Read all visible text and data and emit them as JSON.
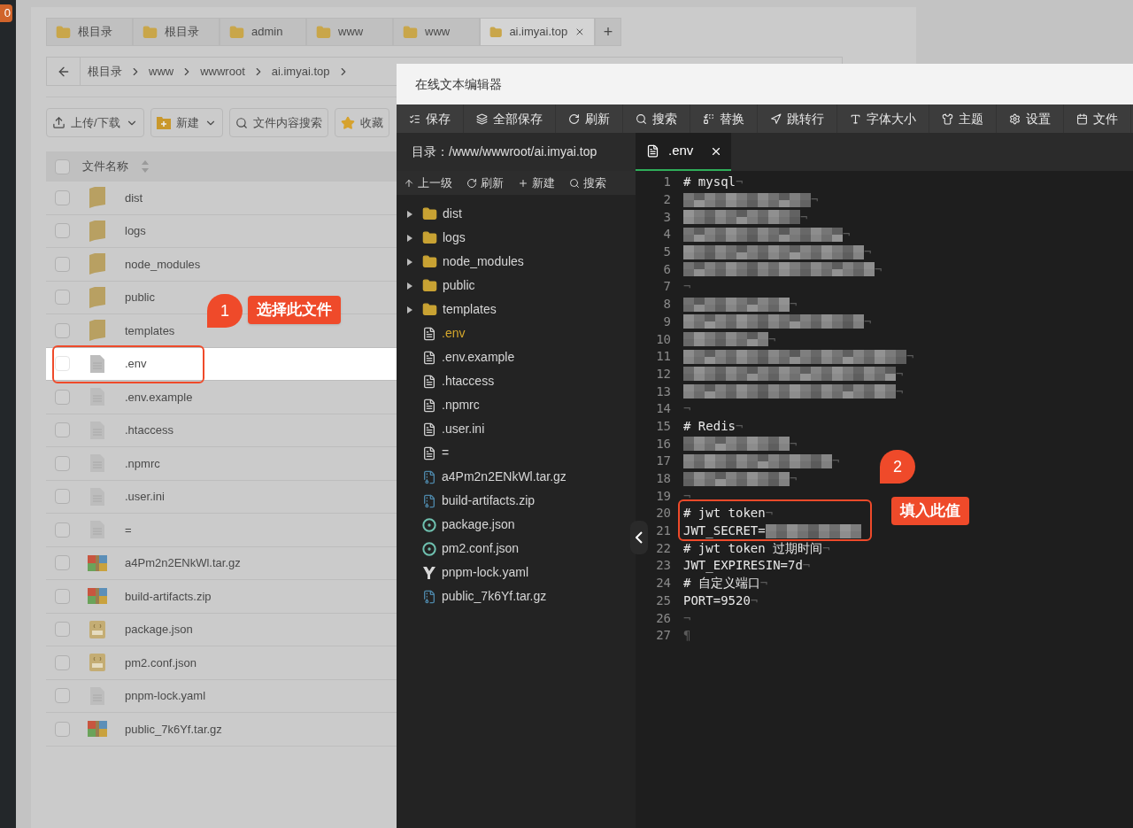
{
  "sidebar_badge": "0",
  "tabs": [
    {
      "label": "根目录",
      "selected": false,
      "closable": false
    },
    {
      "label": "根目录",
      "selected": false,
      "closable": false
    },
    {
      "label": "admin",
      "selected": false,
      "closable": false
    },
    {
      "label": "www",
      "selected": false,
      "closable": false
    },
    {
      "label": "www",
      "selected": false,
      "closable": false
    },
    {
      "label": "ai.imyai.top",
      "selected": true,
      "closable": true
    }
  ],
  "new_tab": "+",
  "breadcrumb": [
    "根目录",
    "www",
    "wwwroot",
    "ai.imyai.top"
  ],
  "toolbar": [
    {
      "label": "上传/下载",
      "kind": "upload"
    },
    {
      "label": "新建",
      "kind": "new"
    },
    {
      "label": "文件内容搜索",
      "kind": "search"
    },
    {
      "label": "收藏",
      "kind": "favorites"
    }
  ],
  "table": {
    "header": "文件名称",
    "header_checked": false,
    "rows": [
      {
        "name": "dist",
        "kind": "folder",
        "highlighted": false
      },
      {
        "name": "logs",
        "kind": "folder",
        "highlighted": false
      },
      {
        "name": "node_modules",
        "kind": "folder",
        "highlighted": false
      },
      {
        "name": "public",
        "kind": "folder",
        "highlighted": false
      },
      {
        "name": "templates",
        "kind": "folder",
        "highlighted": false
      },
      {
        "name": ".env",
        "kind": "file",
        "highlighted": true
      },
      {
        "name": ".env.example",
        "kind": "file",
        "highlighted": false
      },
      {
        "name": ".htaccess",
        "kind": "file",
        "highlighted": false
      },
      {
        "name": ".npmrc",
        "kind": "file",
        "highlighted": false
      },
      {
        "name": ".user.ini",
        "kind": "file",
        "highlighted": false
      },
      {
        "name": "=",
        "kind": "file",
        "highlighted": false
      },
      {
        "name": "a4Pm2n2ENkWl.tar.gz",
        "kind": "archive",
        "highlighted": false
      },
      {
        "name": "build-artifacts.zip",
        "kind": "archive",
        "highlighted": false
      },
      {
        "name": "package.json",
        "kind": "json",
        "highlighted": false
      },
      {
        "name": "pm2.conf.json",
        "kind": "json",
        "highlighted": false
      },
      {
        "name": "pnpm-lock.yaml",
        "kind": "file",
        "highlighted": false
      },
      {
        "name": "public_7k6Yf.tar.gz",
        "kind": "archive",
        "highlighted": false
      }
    ]
  },
  "callouts": [
    {
      "number": "1",
      "label": "选择此文件"
    },
    {
      "number": "2",
      "label": "填入此值"
    }
  ],
  "editor": {
    "title": "在线文本编辑器",
    "toolbar": [
      {
        "label": "保存",
        "kind": "save"
      },
      {
        "label": "全部保存",
        "kind": "save_all"
      },
      {
        "label": "刷新",
        "kind": "refresh"
      },
      {
        "label": "搜索",
        "kind": "search"
      },
      {
        "label": "替换",
        "kind": "replace"
      },
      {
        "label": "跳转行",
        "kind": "goto"
      },
      {
        "label": "字体大小",
        "kind": "font"
      },
      {
        "label": "主题",
        "kind": "theme"
      },
      {
        "label": "设置",
        "kind": "settings"
      },
      {
        "label": "文件",
        "kind": "history"
      }
    ],
    "directory": "目录：/www/wwwroot/ai.imyai.top",
    "file_tabs": [
      {
        "label": ".env",
        "selected": true
      }
    ],
    "tree_toolbar": [
      {
        "label": "上一级",
        "kind": "up"
      },
      {
        "label": "刷新",
        "kind": "refresh"
      },
      {
        "label": "新建",
        "kind": "new"
      },
      {
        "label": "搜索",
        "kind": "search"
      }
    ],
    "tree": [
      {
        "name": "dist",
        "kind": "folder",
        "selected": false
      },
      {
        "name": "logs",
        "kind": "folder",
        "selected": false
      },
      {
        "name": "node_modules",
        "kind": "folder",
        "selected": false
      },
      {
        "name": "public",
        "kind": "folder",
        "selected": false
      },
      {
        "name": "templates",
        "kind": "folder",
        "selected": false
      },
      {
        "name": ".env",
        "kind": "file",
        "selected": true
      },
      {
        "name": ".env.example",
        "kind": "file",
        "selected": false
      },
      {
        "name": ".htaccess",
        "kind": "file",
        "selected": false
      },
      {
        "name": ".npmrc",
        "kind": "file",
        "selected": false
      },
      {
        "name": ".user.ini",
        "kind": "file",
        "selected": false
      },
      {
        "name": "=",
        "kind": "file",
        "selected": false
      },
      {
        "name": "a4Pm2n2ENkWl.tar.gz",
        "kind": "archive",
        "selected": false
      },
      {
        "name": "build-artifacts.zip",
        "kind": "archive",
        "selected": false
      },
      {
        "name": "package.json",
        "kind": "json",
        "selected": false
      },
      {
        "name": "pm2.conf.json",
        "kind": "json",
        "selected": false
      },
      {
        "name": "pnpm-lock.yaml",
        "kind": "yaml",
        "selected": false
      },
      {
        "name": "public_7k6Yf.tar.gz",
        "kind": "archive",
        "selected": false
      }
    ],
    "code_lines": [
      {
        "number": "1",
        "kind": "text",
        "text": "# mysql",
        "eol": "¬"
      },
      {
        "number": "2",
        "kind": "redacted",
        "eol": "¬"
      },
      {
        "number": "3",
        "kind": "redacted",
        "eol": "¬"
      },
      {
        "number": "4",
        "kind": "redacted",
        "eol": "¬"
      },
      {
        "number": "5",
        "kind": "redacted",
        "eol": "¬"
      },
      {
        "number": "6",
        "kind": "redacted",
        "eol": "¬"
      },
      {
        "number": "7",
        "kind": "text",
        "eol": "¬"
      },
      {
        "number": "8",
        "kind": "redacted",
        "eol": "¬"
      },
      {
        "number": "9",
        "kind": "redacted",
        "eol": "¬"
      },
      {
        "number": "10",
        "kind": "redacted",
        "eol": "¬"
      },
      {
        "number": "11",
        "kind": "redacted",
        "eol": "¬"
      },
      {
        "number": "12",
        "kind": "redacted",
        "eol": "¬"
      },
      {
        "number": "13",
        "kind": "redacted",
        "eol": "¬"
      },
      {
        "number": "14",
        "kind": "text",
        "eol": "¬"
      },
      {
        "number": "15",
        "kind": "text",
        "text": "# Redis",
        "eol": "¬"
      },
      {
        "number": "16",
        "kind": "redacted",
        "eol": "¬"
      },
      {
        "number": "17",
        "kind": "redacted",
        "eol": "¬"
      },
      {
        "number": "18",
        "kind": "redacted",
        "eol": "¬"
      },
      {
        "number": "19",
        "kind": "text",
        "eol": "¬"
      },
      {
        "number": "20",
        "kind": "text",
        "text": "# jwt token",
        "eol": "¬"
      },
      {
        "number": "21",
        "kind": "secret",
        "text": "JWT_SECRET="
      },
      {
        "number": "22",
        "kind": "text",
        "text": "# jwt token 过期时间",
        "eol": "¬"
      },
      {
        "number": "23",
        "kind": "text",
        "text": "JWT_EXPIRESIN=7d",
        "eol": "¬"
      },
      {
        "number": "24",
        "kind": "text",
        "text": "# 自定义端口",
        "eol": "¬"
      },
      {
        "number": "25",
        "kind": "text",
        "text": "PORT=9520",
        "eol": "¬"
      },
      {
        "number": "26",
        "kind": "text",
        "eol": "¬"
      },
      {
        "number": "27",
        "kind": "text",
        "eol": "¶"
      }
    ]
  }
}
